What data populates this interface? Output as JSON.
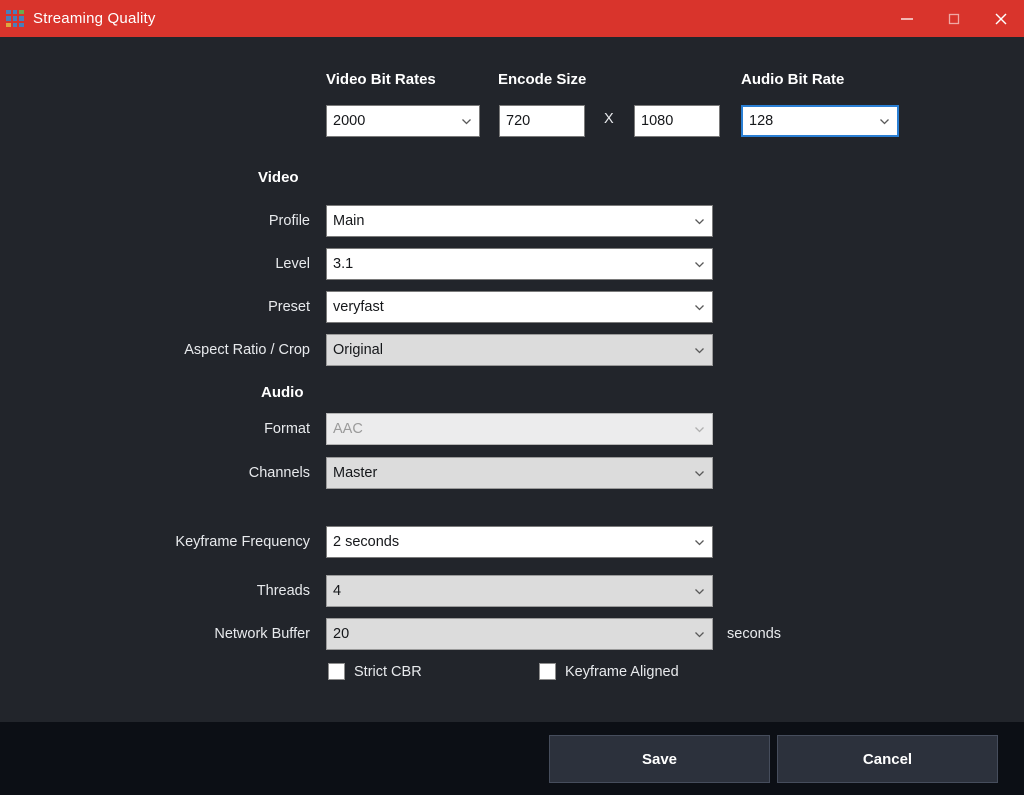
{
  "window": {
    "title": "Streaming Quality",
    "icon": "app-grid-icon",
    "accent_color": "#d9342c",
    "background_color": "#22252b",
    "footer_color": "#0c0f15",
    "controls": {
      "minimize": "minimize-icon",
      "maximize": "maximize-icon",
      "close": "close-icon"
    }
  },
  "top_row": {
    "video_bit_rates": {
      "label": "Video Bit Rates",
      "value": "2000"
    },
    "encode_size": {
      "label": "Encode Size",
      "width": "720",
      "separator": "X",
      "height": "1080"
    },
    "audio_bit_rate": {
      "label": "Audio Bit Rate",
      "value": "128",
      "focus_color": "#2a7fd4"
    }
  },
  "video": {
    "heading": "Video",
    "rows": [
      {
        "label": "Profile",
        "value": "Main",
        "state": "enabled"
      },
      {
        "label": "Level",
        "value": "3.1",
        "state": "enabled"
      },
      {
        "label": "Preset",
        "value": "veryfast",
        "state": "enabled"
      },
      {
        "label": "Aspect Ratio / Crop",
        "value": "Original",
        "state": "grey"
      }
    ]
  },
  "audio": {
    "heading": "Audio",
    "rows": [
      {
        "label": "Format",
        "value": "AAC",
        "state": "disabled"
      },
      {
        "label": "Channels",
        "value": "Master",
        "state": "grey"
      }
    ]
  },
  "advanced": {
    "rows": [
      {
        "label": "Keyframe Frequency",
        "value": "2 seconds",
        "state": "enabled"
      },
      {
        "label": "Threads",
        "value": "4",
        "state": "grey"
      },
      {
        "label": "Network Buffer",
        "value": "20",
        "state": "grey",
        "unit": "seconds"
      }
    ]
  },
  "checkboxes": [
    {
      "label": "Strict CBR",
      "checked": false
    },
    {
      "label": "Keyframe Aligned",
      "checked": false
    }
  ],
  "footer": {
    "save_label": "Save",
    "cancel_label": "Cancel"
  }
}
